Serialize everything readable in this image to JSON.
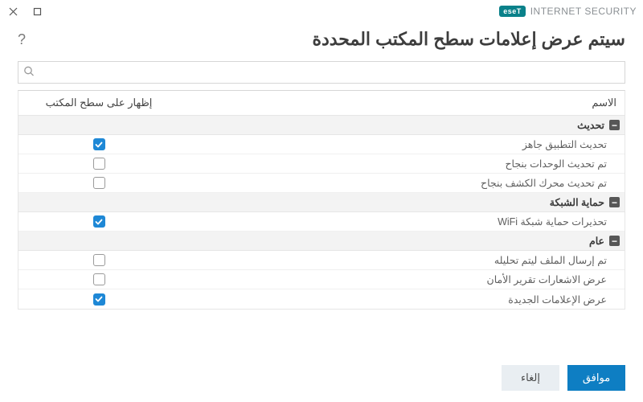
{
  "brand": {
    "logo": "eseT",
    "product": "INTERNET SECURITY"
  },
  "title": "سيتم عرض إعلامات سطح المكتب المحددة",
  "search": {
    "placeholder": "",
    "value": ""
  },
  "columns": {
    "name": "الاسم",
    "show": "إظهار على سطح المكتب"
  },
  "groups": [
    {
      "label": "تحديث",
      "items": [
        {
          "label": "تحديث التطبيق جاهز",
          "checked": true
        },
        {
          "label": "تم تحديث الوحدات بنجاح",
          "checked": false
        },
        {
          "label": "تم تحديث محرك الكشف بنجاح",
          "checked": false
        }
      ]
    },
    {
      "label": "حماية الشبكة",
      "items": [
        {
          "label": "تحذيرات حماية شبكة WiFi",
          "checked": true
        }
      ]
    },
    {
      "label": "عام",
      "items": [
        {
          "label": "تم إرسال الملف ليتم تحليله",
          "checked": false
        },
        {
          "label": "عرض الاشعارات تقرير الأمان",
          "checked": false
        },
        {
          "label": "عرض الإعلامات الجديدة",
          "checked": true
        }
      ]
    }
  ],
  "buttons": {
    "ok": "موافق",
    "cancel": "إلغاء"
  }
}
